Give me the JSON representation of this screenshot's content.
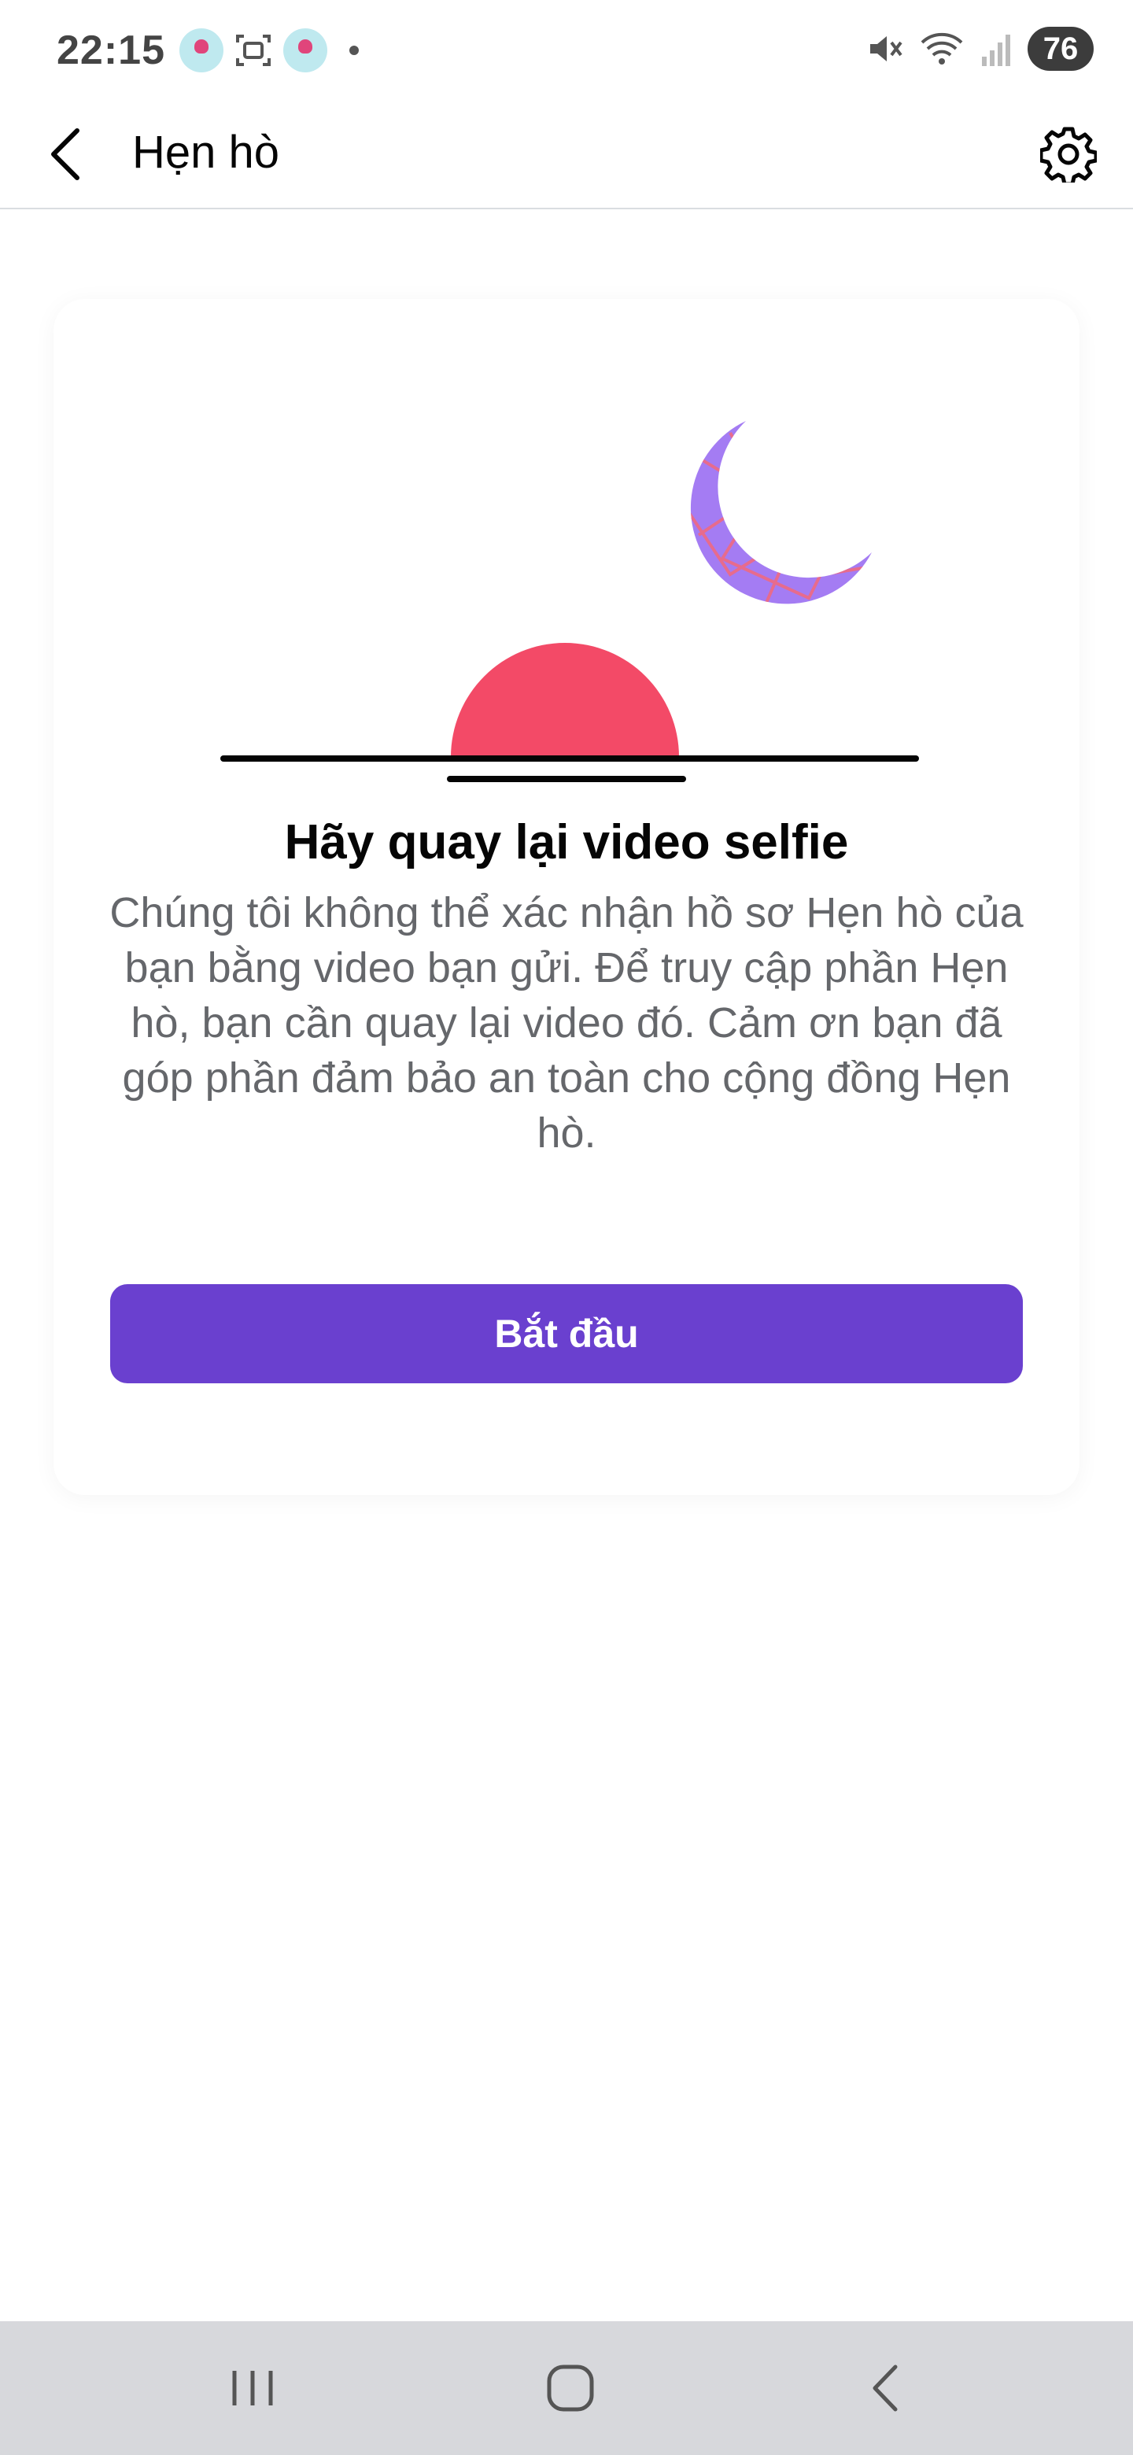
{
  "status_bar": {
    "time": "22:15",
    "battery": "76",
    "icons": [
      "dating-app-notification-icon",
      "screenshot-icon",
      "dating-app-notification-icon",
      "mute-icon",
      "wifi-icon",
      "signal-icon",
      "battery-icon"
    ]
  },
  "header": {
    "title": "Hẹn hò",
    "back_icon": "chevron-left-icon",
    "settings_icon": "gear-icon"
  },
  "card": {
    "title": "Hãy quay lại video selfie",
    "body": "Chúng tôi không thể xác nhận hồ sơ Hẹn hò của bạn bằng video bạn gửi. Để truy cập phần Hẹn hò, bạn cần quay lại video đó. Cảm ơn bạn đã góp phần đảm bảo an toàn cho cộng đồng Hẹn hò.",
    "button_label": "Bắt đầu"
  },
  "colors": {
    "accent": "#6a40cf",
    "sun": "#f34a67",
    "moon": "#a47cf3",
    "moon_lines": "#e76b8d"
  },
  "nav_bar": {
    "icons": [
      "recent-apps-icon",
      "home-icon",
      "back-icon"
    ]
  }
}
